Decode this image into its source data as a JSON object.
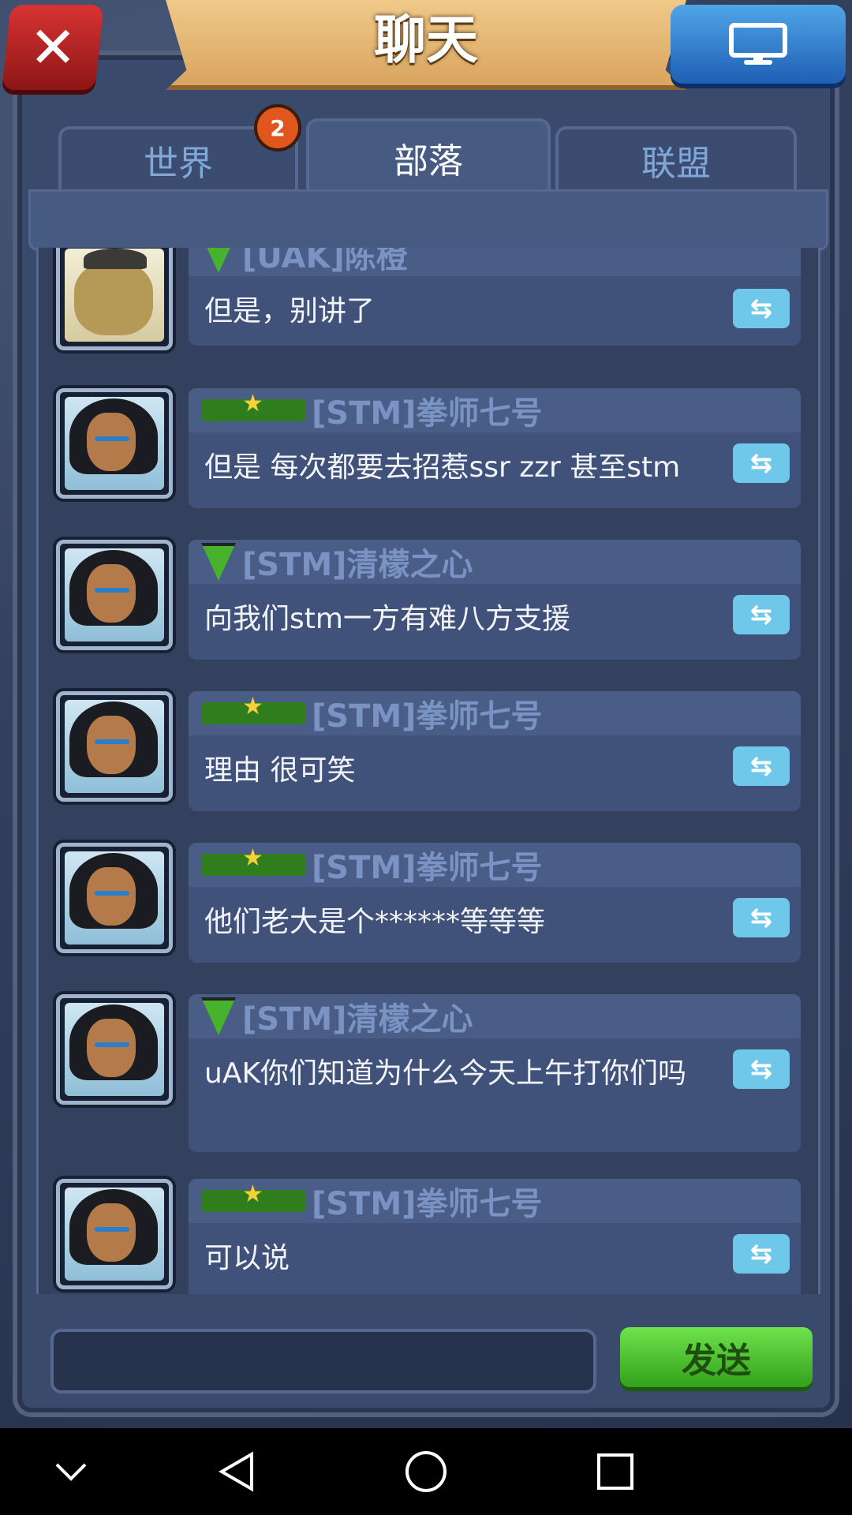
{
  "header": {
    "title": "聊天"
  },
  "tabs": [
    {
      "label": "世界",
      "badge": "2"
    },
    {
      "label": "部落",
      "active": true
    },
    {
      "label": "联盟"
    }
  ],
  "messages": [
    {
      "name": "[UAK]陈橙",
      "rank": "shield",
      "text": "但是，别讲了",
      "avatar": "beast"
    },
    {
      "name": "[STM]拳师七号",
      "rank": "star",
      "text": "但是 每次都要去招惹ssr zzr 甚至stm",
      "avatar": "warrior"
    },
    {
      "name": "[STM]清檬之心",
      "rank": "shield",
      "text": "向我们stm一方有难八方支援",
      "avatar": "warrior"
    },
    {
      "name": "[STM]拳师七号",
      "rank": "star",
      "text": "理由 很可笑",
      "avatar": "warrior"
    },
    {
      "name": "[STM]拳师七号",
      "rank": "star",
      "text": "他们老大是个******等等等",
      "avatar": "warrior"
    },
    {
      "name": "[STM]清檬之心",
      "rank": "shield",
      "text": "uAK你们知道为什么今天上午打你们吗",
      "avatar": "warrior"
    },
    {
      "name": "[STM]拳师七号",
      "rank": "star",
      "text": "可以说",
      "avatar": "warrior"
    }
  ],
  "input": {
    "placeholder": ""
  },
  "send_label": "发送",
  "colors": {
    "accent_green": "#33a11d",
    "panel": "#41527a",
    "tab_text": "#7fa8d8"
  }
}
